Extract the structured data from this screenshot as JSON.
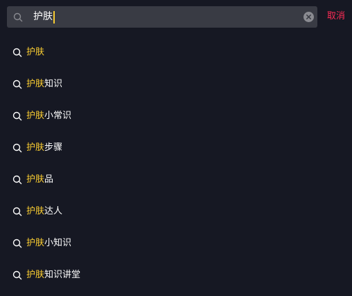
{
  "search": {
    "query": "护肤",
    "cancel_label": "取消"
  },
  "icons": {
    "search": "search-icon",
    "clear": "clear-icon"
  },
  "colors": {
    "background": "#161823",
    "search_field": "#393b44",
    "highlight": "#facd32",
    "cancel": "#fe2c55",
    "text": "#ffffff"
  },
  "suggestions": [
    {
      "match": "护肤",
      "rest": ""
    },
    {
      "match": "护肤",
      "rest": "知识"
    },
    {
      "match": "护肤",
      "rest": "小常识"
    },
    {
      "match": "护肤",
      "rest": "步骤"
    },
    {
      "match": "护肤",
      "rest": "品"
    },
    {
      "match": "护肤",
      "rest": "达人"
    },
    {
      "match": "护肤",
      "rest": "小知识"
    },
    {
      "match": "护肤",
      "rest": "知识讲堂"
    }
  ]
}
